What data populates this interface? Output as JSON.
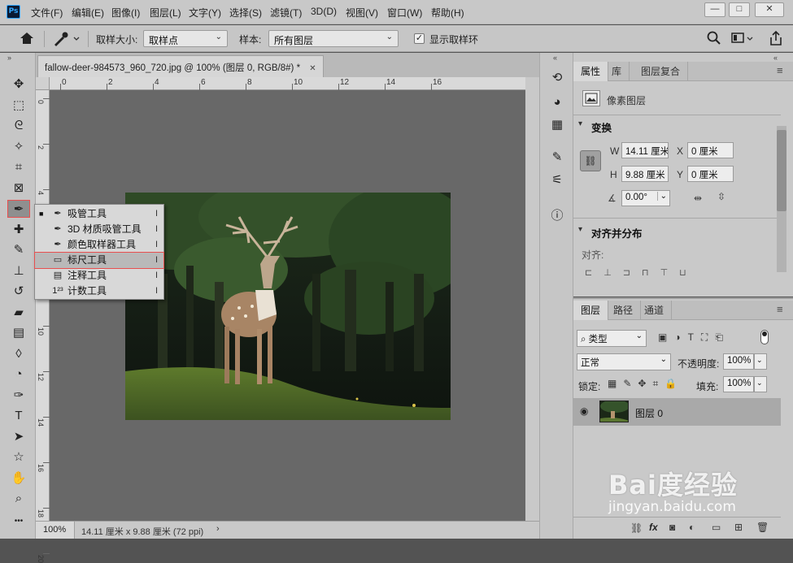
{
  "app": {
    "logo": "Ps"
  },
  "menu": [
    "文件(F)",
    "编辑(E)",
    "图像(I)",
    "图层(L)",
    "文字(Y)",
    "选择(S)",
    "滤镜(T)",
    "3D(D)",
    "视图(V)",
    "窗口(W)",
    "帮助(H)"
  ],
  "window_controls": {
    "minimize": "—",
    "maximize": "□",
    "close": "✕"
  },
  "options": {
    "sample_size_label": "取样大小:",
    "sample_size_value": "取样点",
    "sample_label": "样本:",
    "sample_value": "所有图层",
    "show_ring_label": "显示取样环",
    "show_ring_checked": true
  },
  "document": {
    "tab_title": "fallow-deer-984573_960_720.jpg @ 100% (图层 0, RGB/8#) *",
    "tab_close": "✕",
    "ruler_top_labels": [
      "0",
      "2",
      "4",
      "6",
      "8",
      "10",
      "12",
      "14",
      "16"
    ],
    "ruler_left_labels": [
      "0",
      "2",
      "4",
      "6",
      "8",
      "10",
      "12",
      "14",
      "16",
      "18",
      "20"
    ],
    "zoom": "100%",
    "size_info": "14.11 厘米 x 9.88 厘米 (72 ppi)"
  },
  "tools": [
    {
      "name": "move-tool",
      "glyph": "✥"
    },
    {
      "name": "marquee-tool",
      "glyph": "⬚"
    },
    {
      "name": "lasso-tool",
      "glyph": "ᘓ"
    },
    {
      "name": "magic-wand-tool",
      "glyph": "✧"
    },
    {
      "name": "crop-tool",
      "glyph": "⌗"
    },
    {
      "name": "frame-tool",
      "glyph": "⊠"
    },
    {
      "name": "eyedropper-tool",
      "glyph": "✒"
    },
    {
      "name": "healing-brush-tool",
      "glyph": "✚"
    },
    {
      "name": "brush-tool",
      "glyph": "✎"
    },
    {
      "name": "stamp-tool",
      "glyph": "⊥"
    },
    {
      "name": "history-brush-tool",
      "glyph": "↺"
    },
    {
      "name": "eraser-tool",
      "glyph": "▰"
    },
    {
      "name": "gradient-tool",
      "glyph": "▤"
    },
    {
      "name": "blur-tool",
      "glyph": "◊"
    },
    {
      "name": "dodge-tool",
      "glyph": "◔"
    },
    {
      "name": "pen-tool",
      "glyph": "✑"
    },
    {
      "name": "type-tool",
      "glyph": "T"
    },
    {
      "name": "path-selection-tool",
      "glyph": "➤"
    },
    {
      "name": "shape-tool",
      "glyph": "☆"
    },
    {
      "name": "hand-tool",
      "glyph": "✋"
    },
    {
      "name": "zoom-tool",
      "glyph": "⌕"
    },
    {
      "name": "more-tools",
      "glyph": "•••"
    }
  ],
  "flyout": [
    {
      "label": "吸管工具",
      "icon": "✒",
      "key": "I",
      "current": true
    },
    {
      "label": "3D 材质吸管工具",
      "icon": "✒",
      "key": "I",
      "current": false
    },
    {
      "label": "颜色取样器工具",
      "icon": "✒",
      "key": "I",
      "current": false
    },
    {
      "label": "标尺工具",
      "icon": "▭",
      "key": "I",
      "current": false,
      "highlighted": true
    },
    {
      "label": "注释工具",
      "icon": "▤",
      "key": "I",
      "current": false
    },
    {
      "label": "计数工具",
      "icon": "1²³",
      "key": "I",
      "current": false
    }
  ],
  "dock_icons": [
    {
      "name": "history-panel-icon",
      "glyph": "⟲"
    },
    {
      "name": "color-panel-icon",
      "glyph": "◕"
    },
    {
      "name": "swatches-panel-icon",
      "glyph": "▦"
    },
    {
      "name": "brush-settings-icon",
      "glyph": "✎"
    },
    {
      "name": "adjustments-icon",
      "glyph": "⚟"
    },
    {
      "name": "info-panel-icon",
      "glyph": "ⓘ"
    }
  ],
  "properties": {
    "tabs": [
      "属性",
      "库",
      "图层复合"
    ],
    "layer_kind": "像素图层",
    "transform_title": "变换",
    "w_label": "W",
    "w_value": "14.11 厘米",
    "h_label": "H",
    "h_value": "9.88 厘米",
    "x_label": "X",
    "x_value": "0 厘米",
    "y_label": "Y",
    "y_value": "0 厘米",
    "angle_value": "0.00°",
    "align_title": "对齐并分布",
    "align_label": "对齐:"
  },
  "layers": {
    "tabs": [
      "图层",
      "路径",
      "通道"
    ],
    "filter_kind": "类型",
    "blend_mode": "正常",
    "opacity_label": "不透明度:",
    "opacity_value": "100%",
    "lock_label": "锁定:",
    "fill_label": "填充:",
    "fill_value": "100%",
    "items": [
      {
        "name": "图层 0",
        "visible": true
      }
    ],
    "footer_icons": [
      "link-icon",
      "fx-icon",
      "mask-icon",
      "adjustment-icon",
      "group-icon",
      "new-layer-icon",
      "trash-icon"
    ],
    "fx_label": "fx"
  },
  "watermark": {
    "logo": "Bai度经验",
    "url": "jingyan.baidu.com"
  },
  "colors": {
    "accent_red": "#e84f4f",
    "ps_blue": "#31a8ff"
  }
}
